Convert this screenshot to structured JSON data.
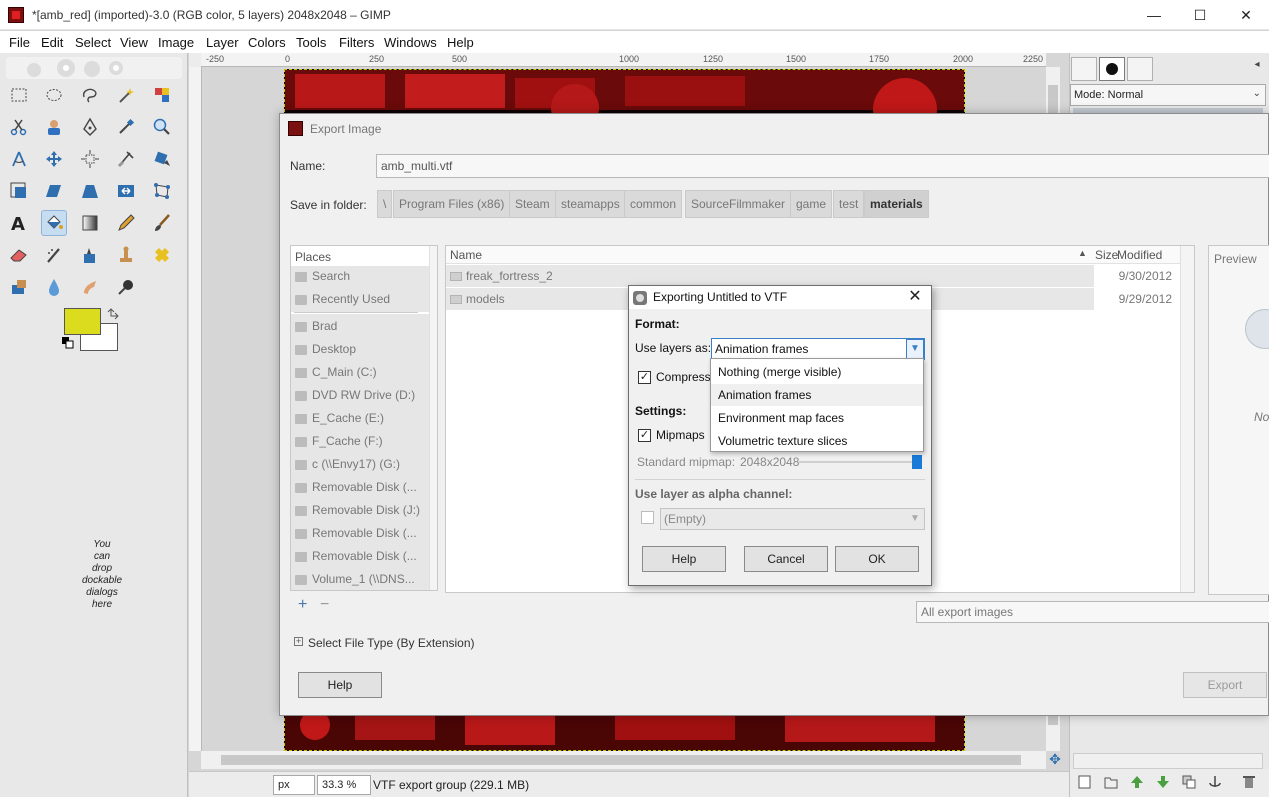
{
  "window": {
    "title": "*[amb_red] (imported)-3.0 (RGB color, 5 layers) 2048x2048 – GIMP",
    "minimize": "—",
    "maximize": "☐",
    "close": "✕"
  },
  "menubar": [
    "File",
    "Edit",
    "Select",
    "View",
    "Image",
    "Layer",
    "Colors",
    "Tools",
    "Filters",
    "Windows",
    "Help"
  ],
  "toolbox": {
    "dock_hint": [
      "You",
      "can",
      "drop",
      "dockable",
      "dialogs",
      "here"
    ],
    "foreground_color": "#dcdc1e",
    "background_color": "#ffffff"
  },
  "rulers": {
    "horizontal": [
      "-250",
      "0",
      "250",
      "500",
      "1000",
      "1250",
      "1500",
      "1750",
      "2000",
      "2250"
    ]
  },
  "statusbar": {
    "unit": "px",
    "zoom": "33.3 %",
    "message": "VTF export group (229.1 MB)"
  },
  "right_dock": {
    "mode_label": "Mode: Normal"
  },
  "export_dialog": {
    "title": "Export Image",
    "name_label": "Name:",
    "name_value": "amb_multi.vtf",
    "folder_label": "Save in folder:",
    "breadcrumbs": [
      "\\",
      "Program Files (x86)",
      "Steam",
      "steamapps",
      "common",
      "SourceFilmmaker",
      "game",
      "test",
      "materials"
    ],
    "places_header": "Places",
    "places": [
      "Search",
      "Recently Used",
      "Brad",
      "Desktop",
      "C_Main (C:)",
      "DVD RW Drive (D:)",
      "E_Cache (E:)",
      "F_Cache (F:)",
      "c (\\\\Envy17) (G:)",
      "Removable Disk (...",
      "Removable Disk (J:)",
      "Removable Disk (...",
      "Removable Disk (...",
      "Volume_1 (\\\\DNS..."
    ],
    "add_icon": "+",
    "remove_icon": "−",
    "columns": {
      "name": "Name",
      "size": "Size",
      "modified": "Modified"
    },
    "files": [
      {
        "name": "freak_fortress_2",
        "modified": "9/30/2012"
      },
      {
        "name": "models",
        "modified": "9/29/2012"
      }
    ],
    "preview_header": "Preview",
    "preview_text": "No",
    "filter": "All export images",
    "select_file_type": "Select File Type (By Extension)",
    "help_button": "Help",
    "export_button": "Export"
  },
  "vtf_dialog": {
    "title": "Exporting Untitled to VTF",
    "format_label": "Format:",
    "use_layers_label": "Use layers as:",
    "use_layers_value": "Animation frames",
    "compress_label": "Compress",
    "settings_label": "Settings:",
    "mipmaps_label": "Mipmaps",
    "standard_mipmap_label": "Standard mipmap:",
    "standard_mipmap_value": "2048x2048",
    "alpha_label": "Use layer as alpha channel:",
    "alpha_value": "(Empty)",
    "help_button": "Help",
    "cancel_button": "Cancel",
    "ok_button": "OK",
    "dropdown_options": [
      "Nothing (merge visible)",
      "Animation frames",
      "Environment map faces",
      "Volumetric texture slices"
    ],
    "dropdown_selected": "Animation frames"
  }
}
